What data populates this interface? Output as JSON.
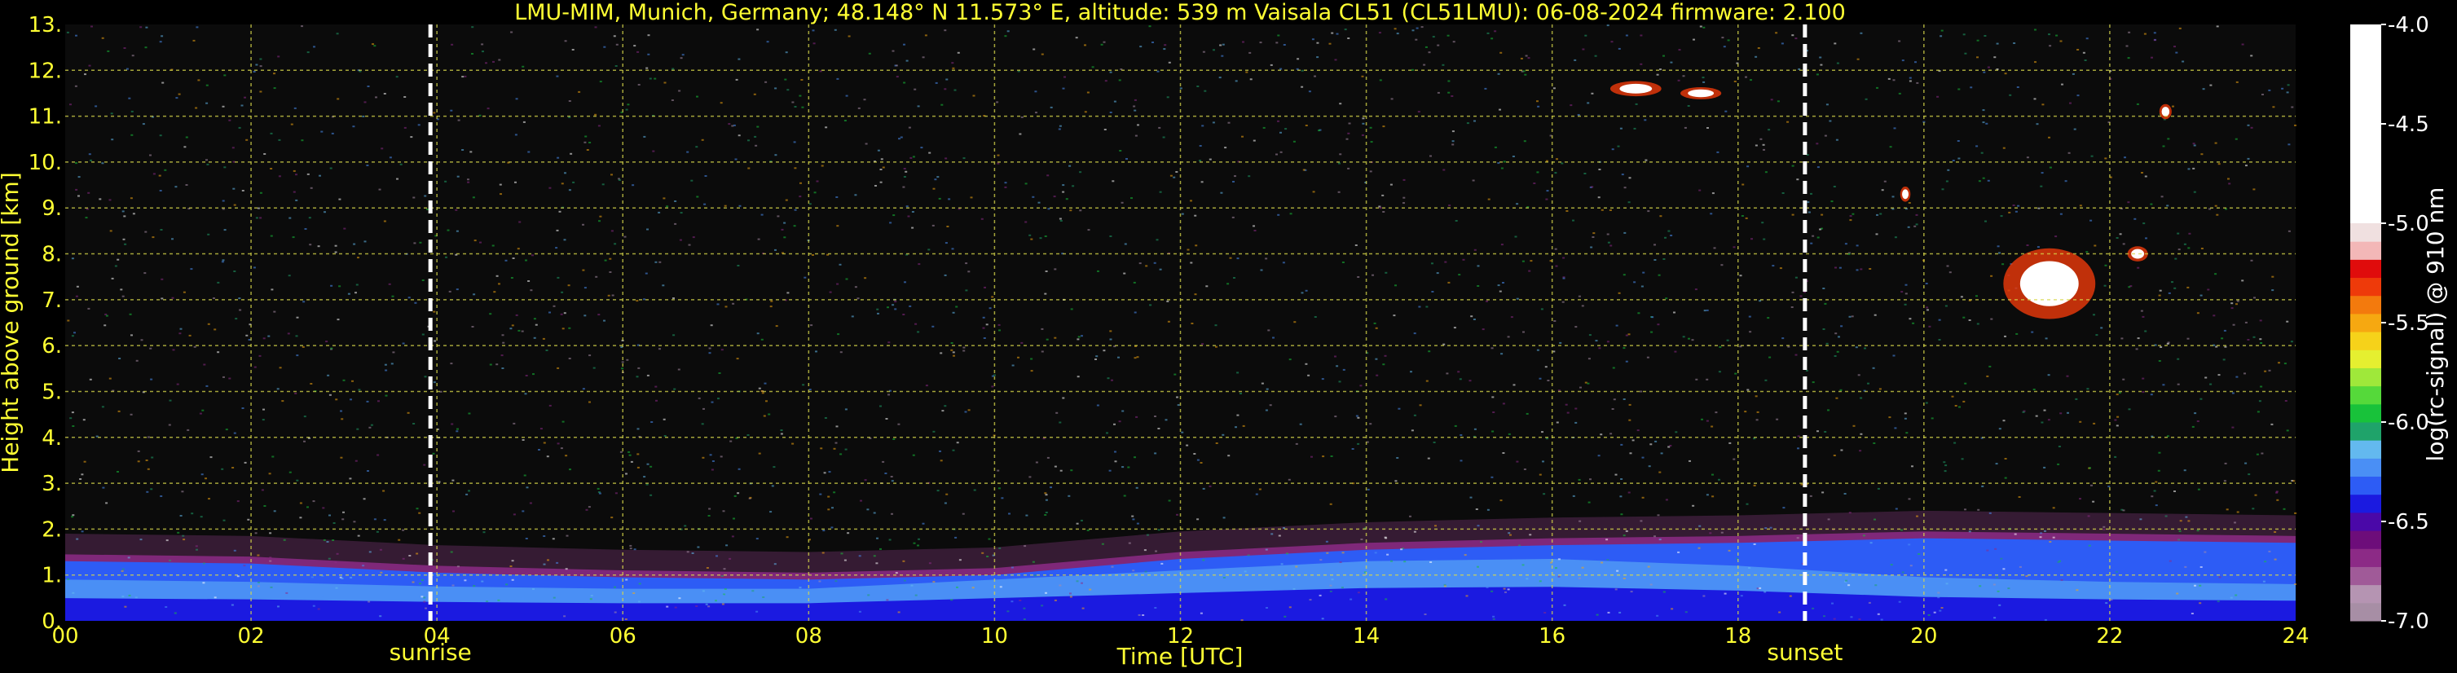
{
  "chart_data": {
    "type": "heatmap",
    "title": "LMU-MIM, Munich, Germany; 48.148° N 11.573° E, altitude: 539 m    Vaisala CL51 (CL51LMU): 06-08-2024    firmware: 2.100",
    "xlabel": "Time [UTC]",
    "ylabel": "Height above ground [km]",
    "xlim": [
      0,
      24
    ],
    "ylim": [
      0,
      13
    ],
    "xticks": [
      "00",
      "02",
      "04",
      "06",
      "08",
      "10",
      "12",
      "14",
      "16",
      "18",
      "20",
      "22",
      "24"
    ],
    "yticks": [
      "0.",
      "1.",
      "2.",
      "3.",
      "4.",
      "5.",
      "6.",
      "7.",
      "8.",
      "9.",
      "10.",
      "11.",
      "12.",
      "13."
    ],
    "grid": true,
    "events": [
      {
        "label": "sunrise",
        "time": 3.93
      },
      {
        "label": "sunset",
        "time": 18.72
      }
    ],
    "layers": [
      {
        "t": 0,
        "top": 1.3,
        "mid": 0.9
      },
      {
        "t": 2,
        "top": 1.25,
        "mid": 0.85
      },
      {
        "t": 4,
        "top": 1.05,
        "mid": 0.75
      },
      {
        "t": 6,
        "top": 0.95,
        "mid": 0.7
      },
      {
        "t": 8,
        "top": 0.9,
        "mid": 0.7
      },
      {
        "t": 10,
        "top": 1.0,
        "mid": 0.9
      },
      {
        "t": 12,
        "top": 1.35,
        "mid": 1.1
      },
      {
        "t": 14,
        "top": 1.55,
        "mid": 1.3
      },
      {
        "t": 16,
        "top": 1.65,
        "mid": 1.35
      },
      {
        "t": 18,
        "top": 1.7,
        "mid": 1.2
      },
      {
        "t": 20,
        "top": 1.8,
        "mid": 0.95
      },
      {
        "t": 22,
        "top": 1.75,
        "mid": 0.85
      },
      {
        "t": 24,
        "top": 1.7,
        "mid": 0.8
      }
    ],
    "clouds": [
      {
        "t": 21.35,
        "h": 7.35,
        "dt": 0.45,
        "dh": 0.7
      },
      {
        "t": 22.3,
        "h": 8.0,
        "dt": 0.1,
        "dh": 0.15
      },
      {
        "t": 16.9,
        "h": 11.6,
        "dt": 0.25,
        "dh": 0.15
      },
      {
        "t": 17.6,
        "h": 11.5,
        "dt": 0.2,
        "dh": 0.12
      },
      {
        "t": 22.6,
        "h": 11.1,
        "dt": 0.06,
        "dh": 0.15
      },
      {
        "t": 19.8,
        "h": 9.3,
        "dt": 0.05,
        "dh": 0.15
      }
    ],
    "colorbar": {
      "label": "log(rc-signal) @ 910 nm",
      "range": [
        -7.0,
        -4.0
      ],
      "ticks": [
        "-4.0",
        "-4.5",
        "-5.0",
        "-5.5",
        "-6.0",
        "-6.5",
        "-7.0"
      ],
      "colors": [
        "#a78ea5",
        "#b594b2",
        "#a05a98",
        "#8c2a86",
        "#6d0d7a",
        "#4a08a8",
        "#1b1ae0",
        "#2d5cf5",
        "#4a8ff5",
        "#63b9ef",
        "#1fa36a",
        "#18c23a",
        "#55d93a",
        "#9fe83a",
        "#e5ef30",
        "#f6d21a",
        "#f6a811",
        "#f37a0d",
        "#ee3a0a",
        "#e00c0c",
        "#f3b7b7",
        "#f0e0e0",
        "#ffffff"
      ]
    }
  }
}
